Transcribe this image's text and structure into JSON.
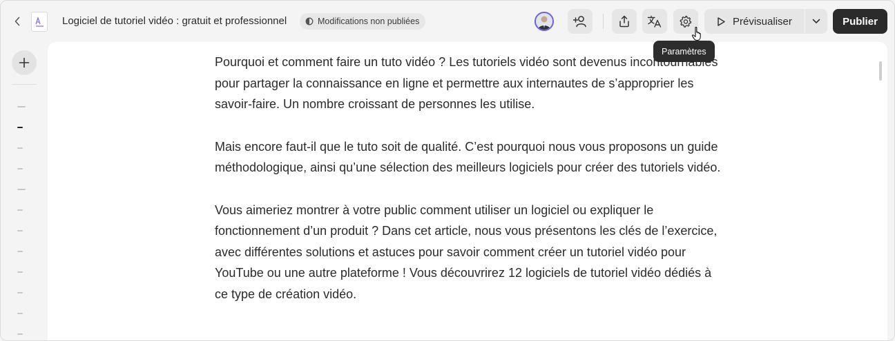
{
  "header": {
    "doc_title": "Logiciel de tutoriel vidéo : gratuit et professionnel",
    "status": "Modifications non publiées",
    "preview_label": "Prévisualiser",
    "publish_label": "Publier",
    "tooltip": "Paramètres"
  },
  "toolbar_icons": [
    "back-icon",
    "document-icon",
    "half-circle-icon",
    "avatar",
    "add-user-icon",
    "share-icon",
    "translate-icon",
    "gear-icon",
    "play-icon",
    "chevron-down-icon"
  ],
  "toc": {
    "item_count": 12,
    "active_index": 1
  },
  "content": {
    "paragraphs": [
      "Pourquoi et comment faire un tuto vidéo ? Les tutoriels vidéo sont devenus incontournables pour partager la connaissance en ligne et permettre aux internautes de s’approprier les savoir-faire. Un nombre croissant de personnes les utilise.",
      "Mais encore faut-il que le tuto soit de qualité. C’est pourquoi nous vous proposons un guide méthodologique, ainsi qu’une sélection des meilleurs logiciels pour créer des tutoriels vidéo.",
      "Vous aimeriez montrer à votre public comment utiliser un logiciel ou expliquer le fonctionnement d’un produit ? Dans cet article, nous vous présentons les clés de l’exercice, avec différentes solutions et astuces pour savoir comment créer un tutoriel vidéo pour YouTube ou une autre plateforme ! Vous découvrirez 12 logiciels de tutoriel vidéo dédiés à ce type de création vidéo."
    ]
  },
  "colors": {
    "background": "#f4f4f4",
    "button": "#e6e6e6",
    "publish": "#2b2b2b",
    "avatar_ring": "#6c5ce7"
  }
}
